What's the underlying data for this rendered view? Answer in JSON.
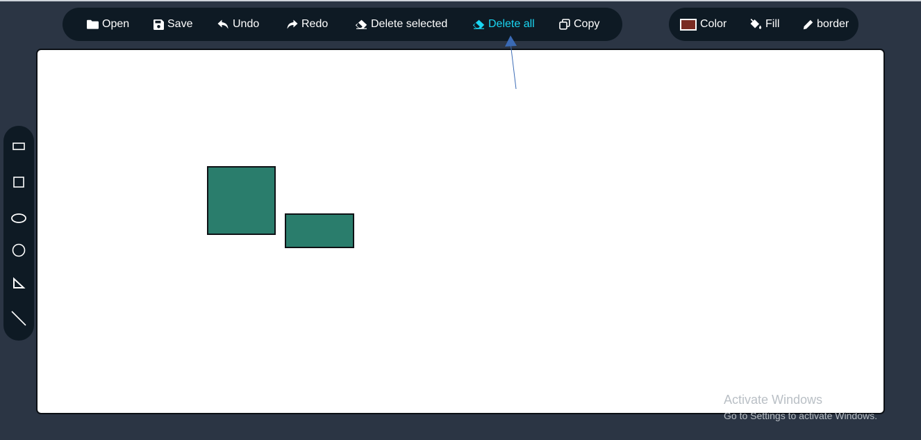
{
  "toolbar": {
    "open_label": "Open",
    "save_label": "Save",
    "undo_label": "Undo",
    "redo_label": "Redo",
    "delete_selected_label": "Delete selected",
    "delete_all_label": "Delete all",
    "copy_label": "Copy",
    "active_item": "Delete all",
    "active_color": "#1ad6f2"
  },
  "style_toolbar": {
    "color_label": "Color",
    "fill_label": "Fill",
    "border_label": "border",
    "current_color": "#7a2b22"
  },
  "side_tools": [
    {
      "icon": "rectangle-icon"
    },
    {
      "icon": "square-icon"
    },
    {
      "icon": "ellipse-icon"
    },
    {
      "icon": "circle-icon"
    },
    {
      "icon": "triangle-icon"
    },
    {
      "icon": "line-icon"
    }
  ],
  "canvas": {
    "shapes": [
      {
        "type": "square",
        "fill": "#2a7d6c",
        "stroke": "#0e1115"
      },
      {
        "type": "rectangle",
        "fill": "#2a7d6c",
        "stroke": "#0e1115"
      }
    ],
    "annotation": {
      "type": "arrow",
      "points_to": "Delete all",
      "color": "#3a6ab5"
    }
  },
  "watermark": {
    "title": "Activate Windows",
    "subtitle": "Go to Settings to activate Windows."
  }
}
